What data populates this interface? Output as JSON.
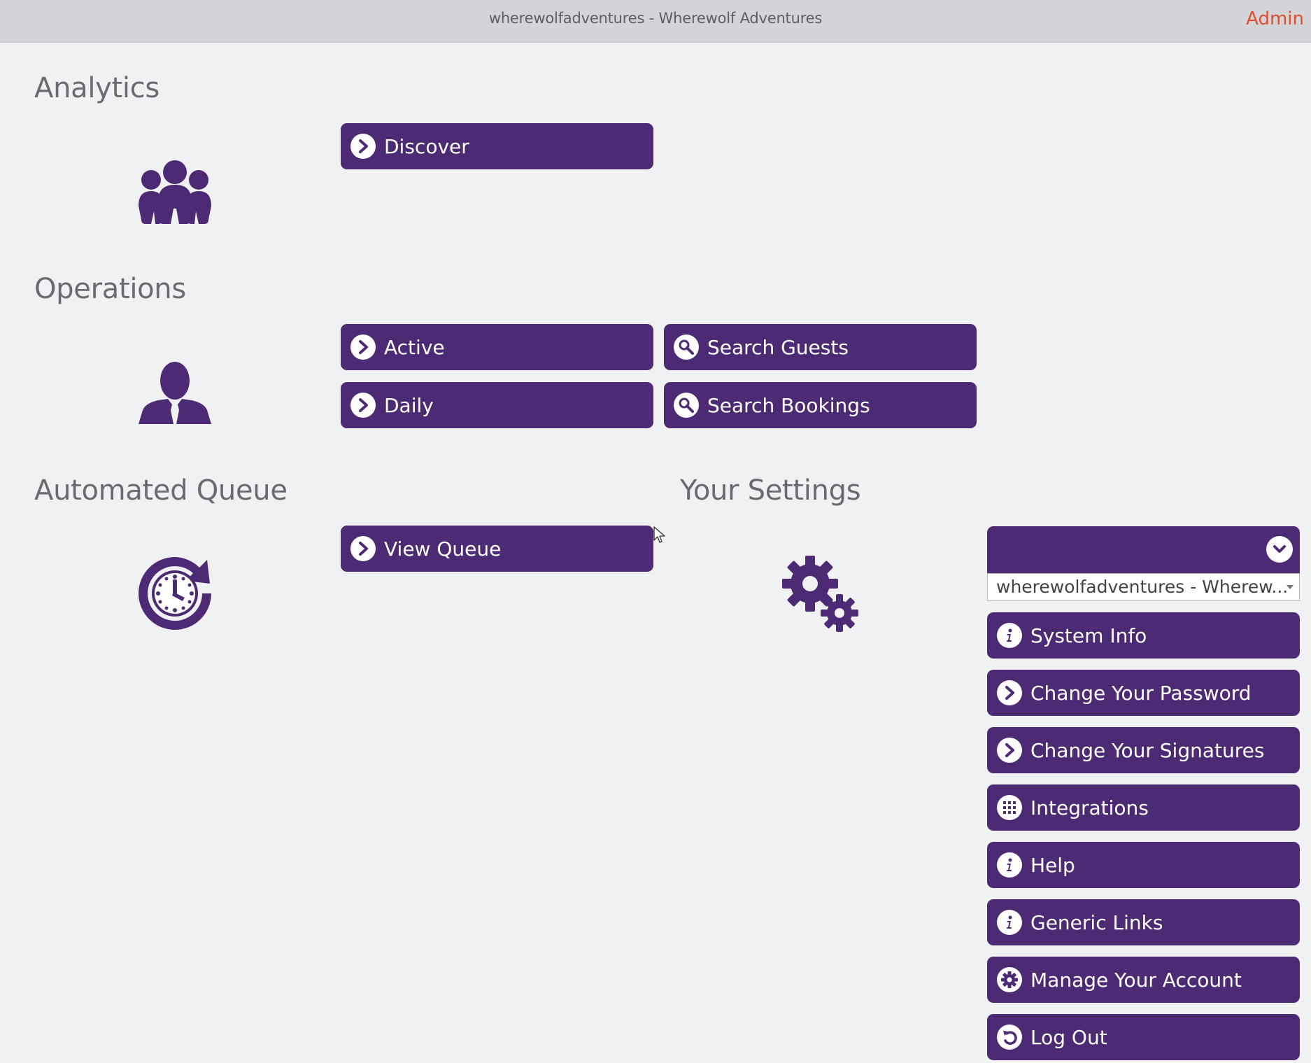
{
  "topbar": {
    "title": "wherewolfadventures - Wherewolf Adventures",
    "admin_label": "Admin"
  },
  "colors": {
    "brand_purple": "#4d2b74",
    "admin_orange": "#e0502f",
    "background": "#f0f1f3"
  },
  "sections": {
    "analytics": {
      "heading": "Analytics",
      "icon": "group-icon",
      "buttons": [
        {
          "label": "Discover",
          "icon": "chevron-right-icon"
        }
      ]
    },
    "operations": {
      "heading": "Operations",
      "icon": "user-icon",
      "buttons": [
        {
          "label": "Active",
          "icon": "chevron-right-icon"
        },
        {
          "label": "Search Guests",
          "icon": "search-icon"
        },
        {
          "label": "Daily",
          "icon": "chevron-right-icon"
        },
        {
          "label": "Search Bookings",
          "icon": "search-icon"
        }
      ]
    },
    "automated_queue": {
      "heading": "Automated Queue",
      "icon": "clock-refresh-icon",
      "buttons": [
        {
          "label": "View Queue",
          "icon": "chevron-right-icon"
        }
      ]
    },
    "settings": {
      "heading": "Your Settings",
      "icon": "gears-icon",
      "account_select_value": "wherewolfadventures - Wherew...",
      "buttons": [
        {
          "label": "System Info",
          "icon": "info-icon"
        },
        {
          "label": "Change Your Password",
          "icon": "chevron-right-icon"
        },
        {
          "label": "Change Your Signatures",
          "icon": "chevron-right-icon"
        },
        {
          "label": "Integrations",
          "icon": "grid-icon"
        },
        {
          "label": "Help",
          "icon": "info-icon"
        },
        {
          "label": "Generic Links",
          "icon": "info-icon"
        },
        {
          "label": "Manage Your Account",
          "icon": "gear-icon"
        },
        {
          "label": "Log Out",
          "icon": "undo-icon"
        }
      ]
    }
  }
}
